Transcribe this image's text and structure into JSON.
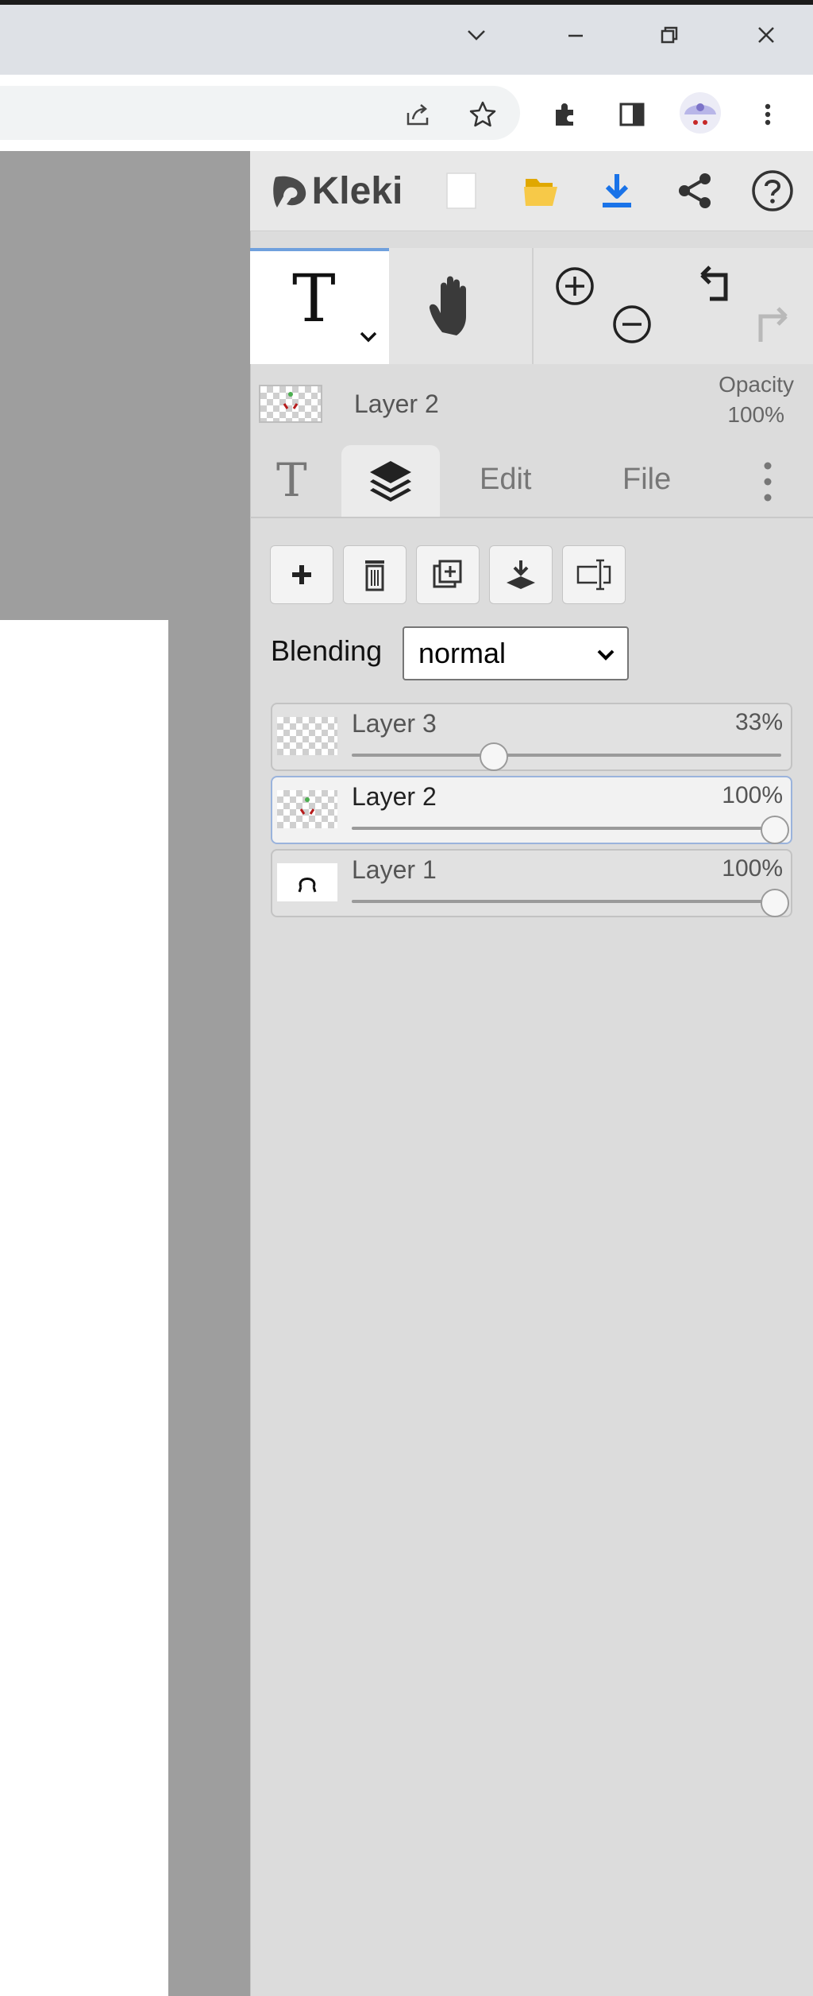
{
  "app": {
    "name": "Kleki"
  },
  "browser": {
    "window_controls": [
      "chevron-down-icon",
      "minimize-icon",
      "restore-icon",
      "close-icon"
    ],
    "toolbar_icons": [
      "share-icon",
      "bookmark-star-icon",
      "extensions-icon",
      "side-panel-icon",
      "profile-avatar",
      "more-vert-icon"
    ]
  },
  "topbar": {
    "logo_text": "Kleki"
  },
  "layer_info": {
    "name": "Layer 2",
    "opacity_label": "Opacity",
    "opacity_value": "100%"
  },
  "tabs": [
    {
      "label": "T",
      "icon": "text-tool-icon"
    },
    {
      "label": "",
      "icon": "layers-icon",
      "active": true
    },
    {
      "label": "Edit"
    },
    {
      "label": "File"
    }
  ],
  "layer_buttons": [
    "add-layer-icon",
    "delete-layer-icon",
    "duplicate-layer-icon",
    "merge-down-icon",
    "rename-layer-icon"
  ],
  "blending": {
    "label": "Blending",
    "value": "normal"
  },
  "layers": [
    {
      "name": "Layer 3",
      "opacity": "33%",
      "opacity_fraction": 0.33,
      "selected": false
    },
    {
      "name": "Layer 2",
      "opacity": "100%",
      "opacity_fraction": 1.0,
      "selected": true
    },
    {
      "name": "Layer 1",
      "opacity": "100%",
      "opacity_fraction": 1.0,
      "selected": false
    }
  ],
  "colors": {
    "accent": "#6fa0dd",
    "download": "#1a73e8",
    "folder": "#f5c518",
    "canvas_bg": "#9e9e9e"
  }
}
